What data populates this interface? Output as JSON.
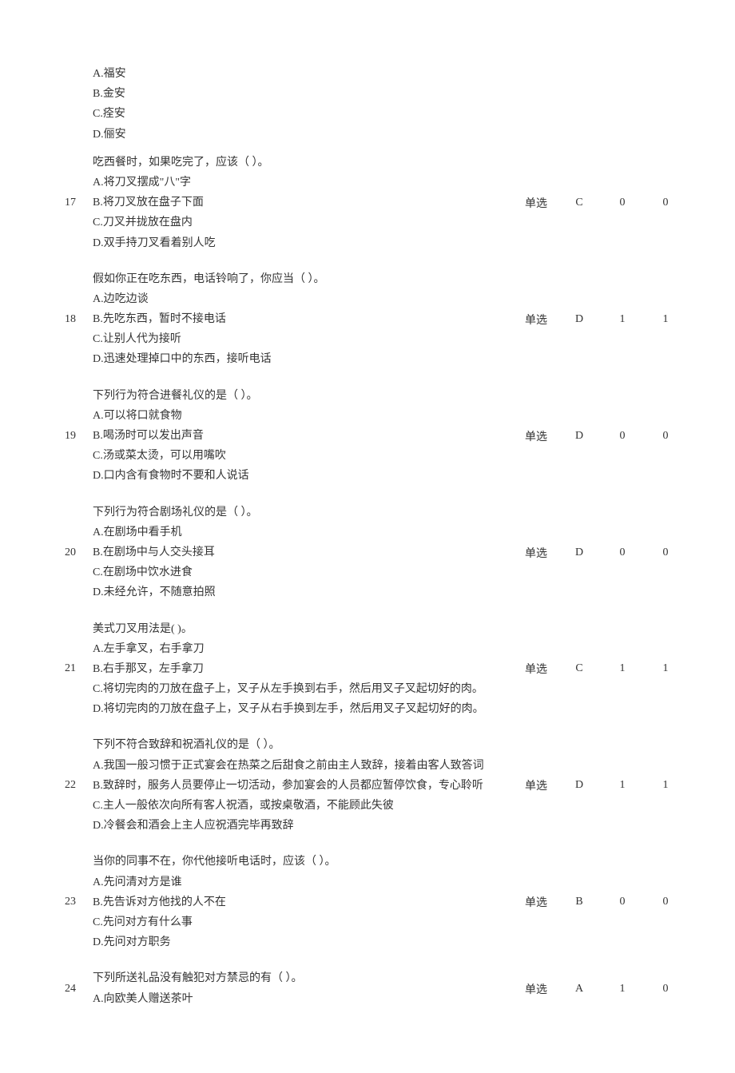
{
  "orphan": {
    "lines": [
      "A.福安",
      "B.金安",
      "C.痊安",
      "D.俪安"
    ]
  },
  "questions": [
    {
      "num": "17",
      "lines": [
        "吃西餐时，如果吃完了，应该（ ）。",
        "A.将刀叉摆成\"八\"字",
        "B.将刀叉放在盘子下面",
        "C.刀叉并拢放在盘内",
        "D.双手持刀叉看着别人吃"
      ],
      "type": "单选",
      "ans": "C",
      "c1": "0",
      "c2": "0"
    },
    {
      "num": "18",
      "lines": [
        "假如你正在吃东西，电话铃响了，你应当（ ）。",
        "A.边吃边谈",
        "B.先吃东西，暂时不接电话",
        "C.让别人代为接听",
        "D.迅速处理掉口中的东西，接听电话"
      ],
      "type": "单选",
      "ans": "D",
      "c1": "1",
      "c2": "1"
    },
    {
      "num": "19",
      "lines": [
        "下列行为符合进餐礼仪的是（ ）。",
        "A.可以将口就食物",
        "B.喝汤时可以发出声音",
        "C.汤或菜太烫，可以用嘴吹",
        "D.口内含有食物时不要和人说话"
      ],
      "type": "单选",
      "ans": "D",
      "c1": "0",
      "c2": "0"
    },
    {
      "num": "20",
      "lines": [
        "下列行为符合剧场礼仪的是（ ）。",
        "A.在剧场中看手机",
        "B.在剧场中与人交头接耳",
        "C.在剧场中饮水进食",
        "D.未经允许，不随意拍照"
      ],
      "type": "单选",
      "ans": "D",
      "c1": "0",
      "c2": "0"
    },
    {
      "num": "21",
      "lines": [
        "美式刀叉用法是( )。",
        "A.左手拿叉，右手拿刀",
        "B.右手那叉，左手拿刀",
        "C.将切完肉的刀放在盘子上，叉子从左手换到右手，然后用叉子叉起切好的肉。",
        "D.将切完肉的刀放在盘子上，叉子从右手换到左手，然后用叉子叉起切好的肉。"
      ],
      "type": "单选",
      "ans": "C",
      "c1": "1",
      "c2": "1"
    },
    {
      "num": "22",
      "lines": [
        "下列不符合致辞和祝酒礼仪的是（ ）。",
        "A.我国一般习惯于正式宴会在热菜之后甜食之前由主人致辞，接着由客人致答词",
        "B.致辞时，服务人员要停止一切活动，参加宴会的人员都应暂停饮食，专心聆听",
        "C.主人一般依次向所有客人祝酒，或按桌敬酒，不能顾此失彼",
        "D.冷餐会和酒会上主人应祝酒完毕再致辞"
      ],
      "type": "单选",
      "ans": "D",
      "c1": "1",
      "c2": "1"
    },
    {
      "num": "23",
      "lines": [
        "当你的同事不在，你代他接听电话时，应该（ ）。",
        "A.先问清对方是谁",
        "B.先告诉对方他找的人不在",
        "C.先问对方有什么事",
        "D.先问对方职务"
      ],
      "type": "单选",
      "ans": "B",
      "c1": "0",
      "c2": "0"
    },
    {
      "num": "24",
      "lines": [
        "下列所送礼品没有触犯对方禁忌的有（ ）。",
        "A.向欧美人赠送茶叶"
      ],
      "type": "单选",
      "ans": "A",
      "c1": "1",
      "c2": "0"
    }
  ]
}
